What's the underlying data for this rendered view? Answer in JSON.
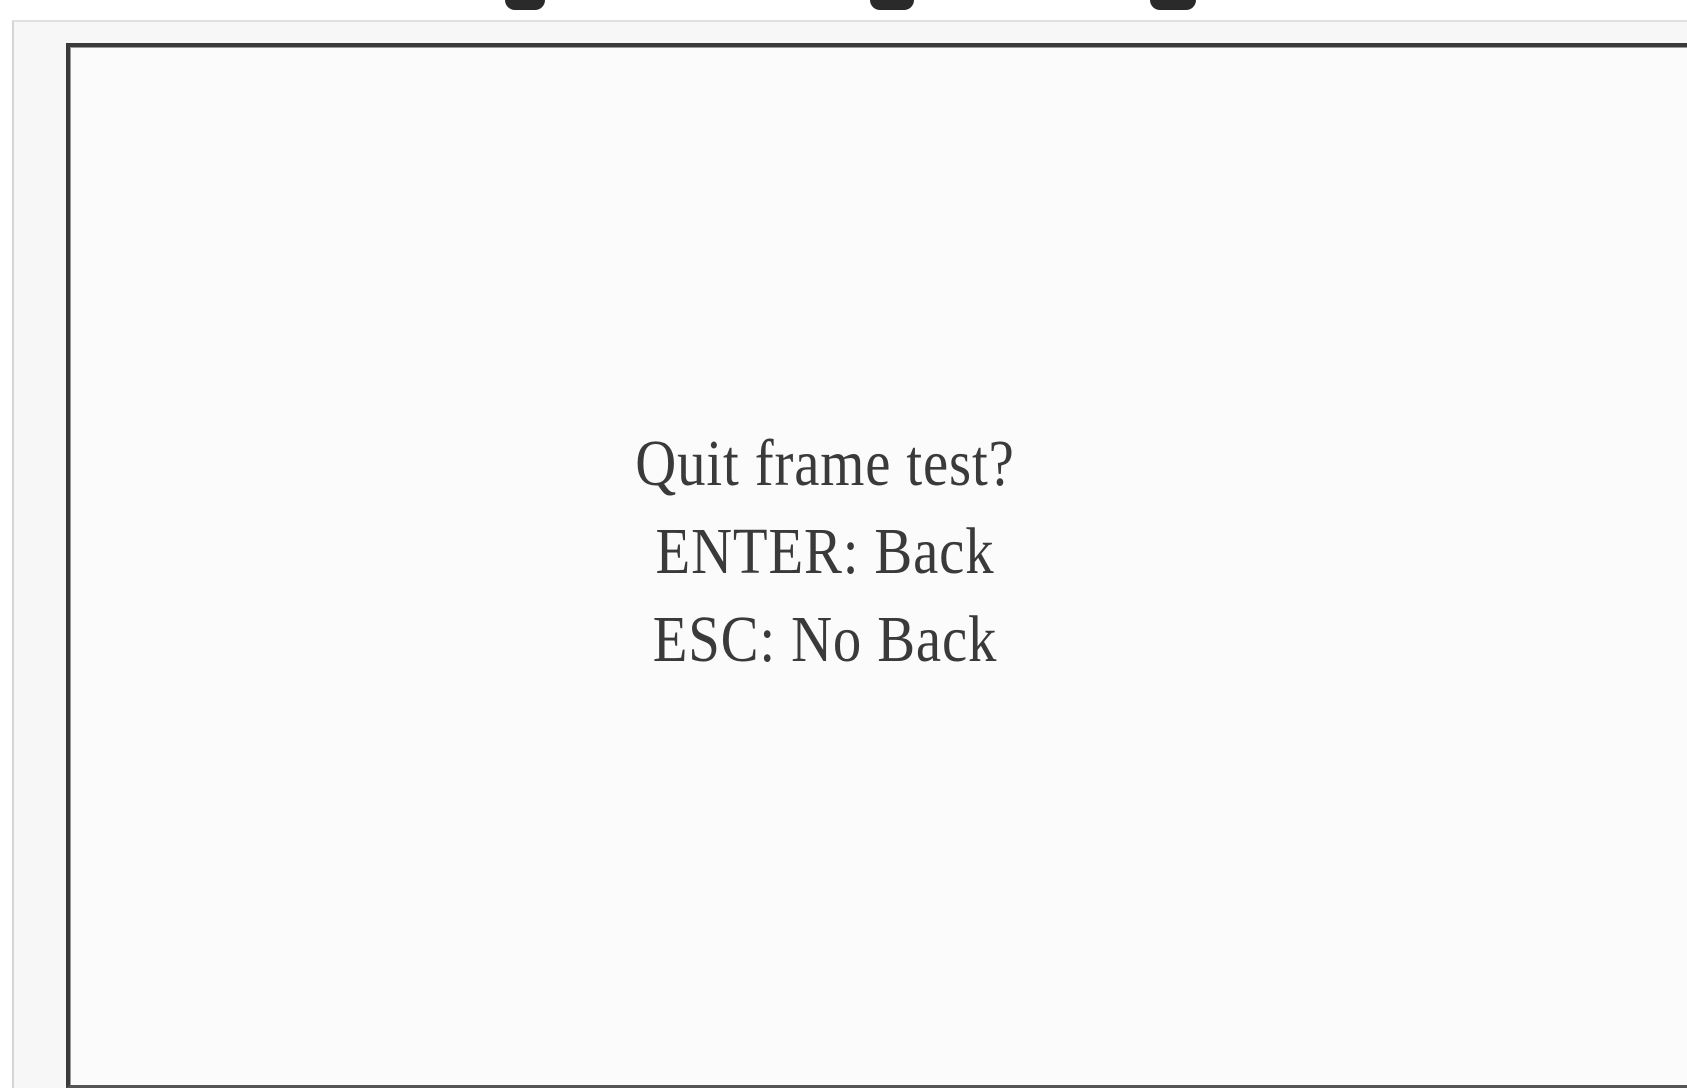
{
  "dialog": {
    "question": "Quit frame test?",
    "enter_action": "ENTER: Back",
    "esc_action": "ESC: No Back"
  },
  "colors": {
    "screen_background": "#fbfbfb",
    "frame_border": "#3a3a3a",
    "text": "#3a3a3a"
  }
}
